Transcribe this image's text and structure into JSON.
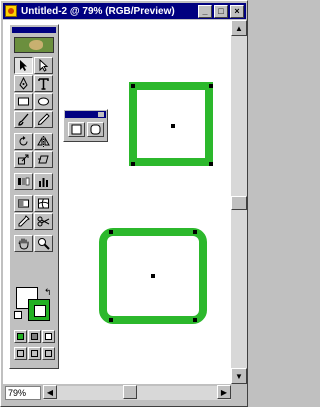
{
  "window": {
    "title": "Untitled-2 @ 79% (RGB/Preview)",
    "minimize_label": "_",
    "maximize_label": "□",
    "close_label": "×"
  },
  "status": {
    "zoom": "79%"
  },
  "toolbox": {
    "tools": [
      "selection-tool",
      "direct-selection-tool",
      "pen-tool",
      "type-tool",
      "rectangle-tool",
      "ellipse-tool",
      "paintbrush-tool",
      "pencil-tool",
      "rotate-tool",
      "reflect-tool",
      "scale-tool",
      "shear-tool",
      "blend-tool",
      "graph-tool",
      "gradient-tool",
      "mesh-tool",
      "eyedropper-tool",
      "scissors-tool",
      "hand-tool",
      "zoom-tool"
    ],
    "fill_color": "#ffffff",
    "stroke_color": "#22b022"
  },
  "shapes": {
    "stroke_color": "#2cb82c",
    "items": [
      {
        "kind": "square"
      },
      {
        "kind": "rounded-rectangle"
      }
    ]
  }
}
